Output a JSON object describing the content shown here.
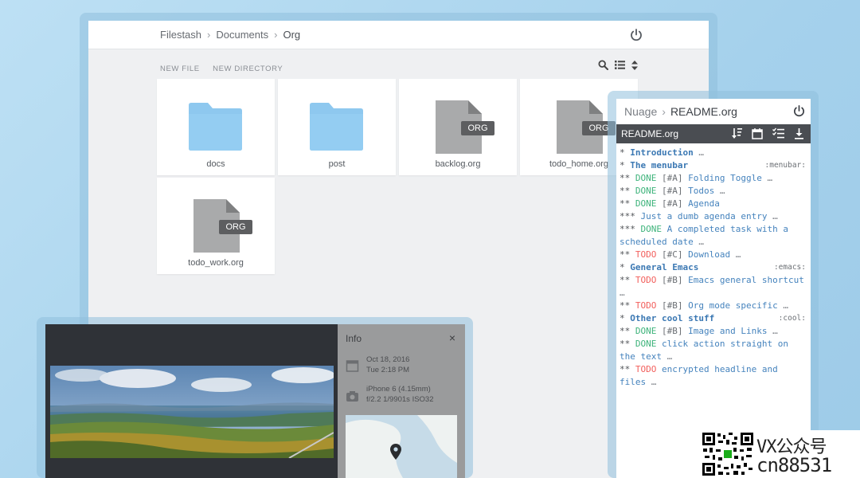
{
  "file_manager": {
    "breadcrumb": [
      "Filestash",
      "Documents",
      "Org"
    ],
    "actions": {
      "new_file": "NEW FILE",
      "new_directory": "NEW DIRECTORY"
    },
    "tool_icons": [
      "search-icon",
      "list-view-icon",
      "sort-icon"
    ],
    "items": [
      {
        "name": "docs",
        "type": "folder"
      },
      {
        "name": "post",
        "type": "folder"
      },
      {
        "name": "backlog.org",
        "type": "file",
        "badge": "ORG"
      },
      {
        "name": "todo_home.org",
        "type": "file",
        "badge": "ORG"
      },
      {
        "name": "todo_work.org",
        "type": "file",
        "badge": "ORG"
      }
    ]
  },
  "org_viewer": {
    "breadcrumb": [
      "Nuage",
      "README.org"
    ],
    "filename": "README.org",
    "bar_icons": [
      "sort-down-icon",
      "calendar-icon",
      "checklist-icon",
      "download-icon"
    ],
    "lines": [
      {
        "stars": "*",
        "keyword": "",
        "priority": "",
        "text": "Introduction",
        "ellipsis": " …",
        "tag": "",
        "level": 1
      },
      {
        "stars": "*",
        "keyword": "",
        "priority": "",
        "text": "The menubar",
        "ellipsis": "",
        "tag": ":menubar:",
        "level": 1
      },
      {
        "stars": "**",
        "keyword": "DONE",
        "priority": "[#A]",
        "text": "Folding Toggle",
        "ellipsis": " …",
        "tag": "",
        "level": 2
      },
      {
        "stars": "**",
        "keyword": "DONE",
        "priority": "[#A]",
        "text": "Todos",
        "ellipsis": " …",
        "tag": "",
        "level": 2
      },
      {
        "stars": "**",
        "keyword": "DONE",
        "priority": "[#A]",
        "text": "Agenda",
        "ellipsis": "",
        "tag": "",
        "level": 2
      },
      {
        "stars": "***",
        "keyword": "",
        "priority": "",
        "text": "Just a dumb agenda entry",
        "ellipsis": " …",
        "tag": "",
        "level": 3
      },
      {
        "stars": "***",
        "keyword": "DONE",
        "priority": "",
        "text": "A completed task with a scheduled date",
        "ellipsis": " …",
        "tag": "",
        "level": 3
      },
      {
        "stars": "**",
        "keyword": "TODO",
        "priority": "[#C]",
        "text": "Download",
        "ellipsis": " …",
        "tag": "",
        "level": 2
      },
      {
        "stars": "*",
        "keyword": "",
        "priority": "",
        "text": "General Emacs",
        "ellipsis": "",
        "tag": ":emacs:",
        "level": 1
      },
      {
        "stars": "**",
        "keyword": "TODO",
        "priority": "[#B]",
        "text": "Emacs general shortcut",
        "ellipsis": " …",
        "tag": "",
        "level": 2
      },
      {
        "stars": "**",
        "keyword": "TODO",
        "priority": "[#B]",
        "text": "Org mode specific",
        "ellipsis": " …",
        "tag": "",
        "level": 2
      },
      {
        "stars": "*",
        "keyword": "",
        "priority": "",
        "text": "Other cool stuff",
        "ellipsis": "",
        "tag": ":cool:",
        "level": 1
      },
      {
        "stars": "**",
        "keyword": "DONE",
        "priority": "[#B]",
        "text": "Image and Links",
        "ellipsis": " …",
        "tag": "",
        "level": 2
      },
      {
        "stars": "**",
        "keyword": "DONE",
        "priority": "",
        "text": "click action straight on the text",
        "ellipsis": " …",
        "tag": "",
        "level": 2
      },
      {
        "stars": "**",
        "keyword": "TODO",
        "priority": "",
        "text": "encrypted headline and files",
        "ellipsis": " …",
        "tag": "",
        "level": 2
      }
    ]
  },
  "image_viewer": {
    "info_title": "Info",
    "close_label": "×",
    "date_line1": "Oct 18, 2016",
    "date_line2": "Tue 2:18 PM",
    "camera_line1": "iPhone 6 (4.15mm)",
    "camera_line2": "f/2.2 1/9901s ISO32"
  },
  "watermark": {
    "line1": "VX公众号",
    "line2": "cn88531"
  },
  "colors": {
    "background": "#a7d2ec",
    "folder": "#8ec8ef",
    "done": "#3db37a",
    "todo": "#f25f5c",
    "headline": "#3b78b3"
  }
}
